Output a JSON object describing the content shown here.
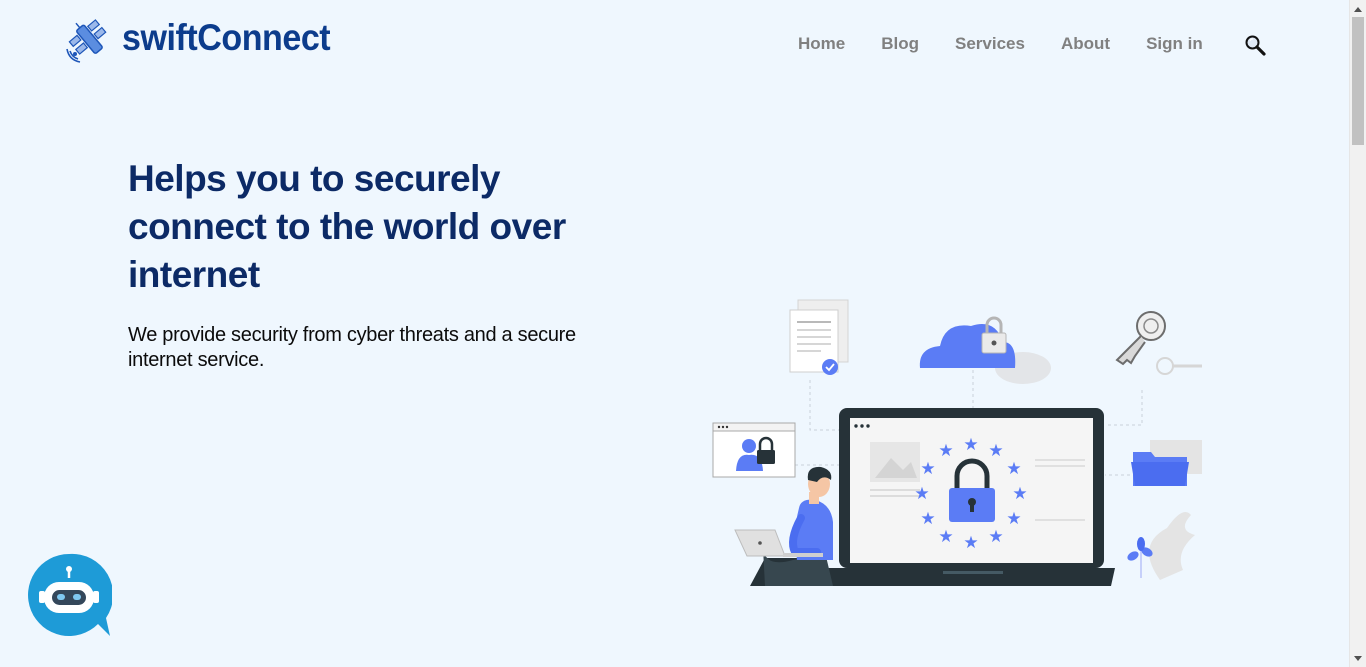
{
  "header": {
    "brand": "swiftConnect",
    "nav": [
      {
        "label": "Home"
      },
      {
        "label": "Blog"
      },
      {
        "label": "Services"
      },
      {
        "label": "About"
      },
      {
        "label": "Sign in"
      }
    ],
    "search_icon": "magnifier-icon"
  },
  "hero": {
    "title": "Helps you to securely connect to the world over internet",
    "subtitle": "We provide security from cyber threats and a secure internet service.",
    "illustration": "cyber-security-illustration"
  },
  "chatbot": {
    "icon": "robot-chat-icon"
  },
  "colors": {
    "background": "#eff7fe",
    "brand": "#0c3c8c",
    "title": "#0c2a66",
    "nav": "#808080",
    "accent": "#5b7cf5",
    "chat_bubble": "#1e9bd7"
  }
}
